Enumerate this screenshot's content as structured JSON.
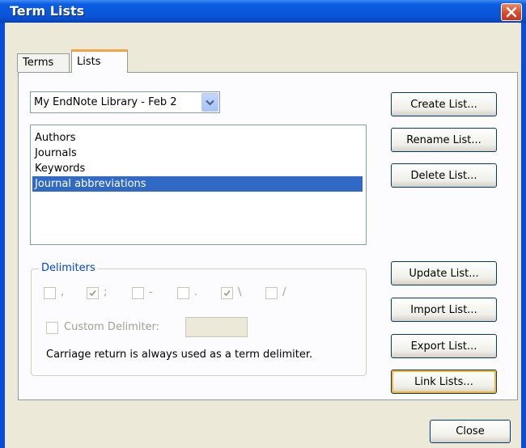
{
  "window": {
    "title": "Term Lists"
  },
  "tabs": [
    {
      "label": "Terms"
    },
    {
      "label": "Lists"
    }
  ],
  "library_dropdown": {
    "value": "My EndNote Library - Feb 2"
  },
  "lists": [
    "Authors",
    "Journals",
    "Keywords",
    "Journal abbreviations"
  ],
  "selected_list": "Journal abbreviations",
  "delimiters": {
    "group_label": "Delimiters",
    "items": [
      {
        "symbol": ",",
        "checked": false
      },
      {
        "symbol": ";",
        "checked": true
      },
      {
        "symbol": "-",
        "checked": false
      },
      {
        "symbol": ".",
        "checked": false
      },
      {
        "symbol": "\\",
        "checked": true
      },
      {
        "symbol": "/",
        "checked": false
      }
    ],
    "custom_label": "Custom Delimiter:",
    "custom_value": "",
    "note": "Carriage return is always used as a term delimiter."
  },
  "buttons": {
    "create": "Create List...",
    "rename": "Rename List...",
    "delete": "Delete List...",
    "update": "Update List...",
    "import": "Import List...",
    "export": "Export List...",
    "link": "Link Lists...",
    "close": "Close"
  },
  "colors": {
    "titlebar": "#0a55d8",
    "selection": "#316ac5",
    "focus_ring": "#f8b636",
    "group_label": "#0046d5"
  }
}
